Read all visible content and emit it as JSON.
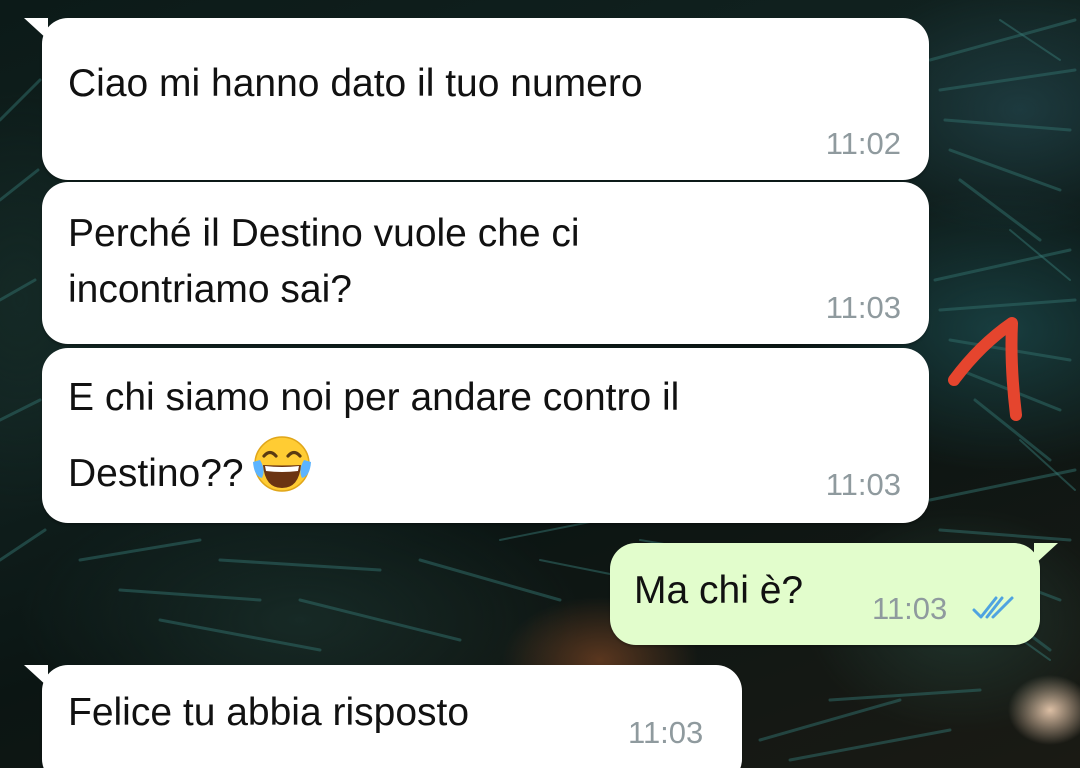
{
  "chat": {
    "messages": [
      {
        "direction": "incoming",
        "text": "Ciao mi hanno dato il tuo numero",
        "time": "11:02"
      },
      {
        "direction": "incoming",
        "lines": [
          "Perché il Destino vuole che ci",
          "incontriamo sai?"
        ],
        "time": "11:03"
      },
      {
        "direction": "incoming",
        "lines": [
          "E chi siamo noi per andare contro il",
          "Destino??"
        ],
        "emoji": "laughing-tears",
        "time": "11:03"
      },
      {
        "direction": "outgoing",
        "text": "Ma chi è?",
        "time": "11:03",
        "status": "read",
        "status_icon": "double-check-icon"
      },
      {
        "direction": "incoming",
        "text": "Felice tu abbia risposto",
        "time": "11:03"
      }
    ]
  },
  "annotation": {
    "shape": "hand-drawn arrow",
    "color": "#e5452e"
  },
  "colors": {
    "incoming_bubble": "#ffffff",
    "outgoing_bubble": "#e2fdcc",
    "timestamp": "#8f9a9e",
    "read_ticks": "#4fa3e0"
  }
}
